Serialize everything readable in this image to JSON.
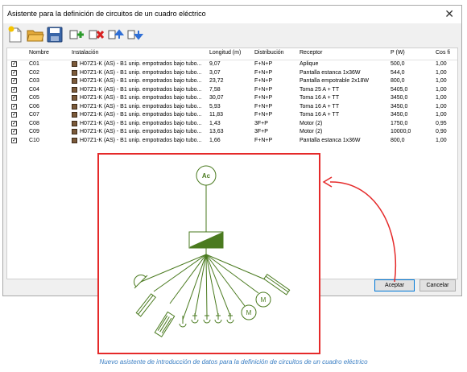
{
  "window": {
    "title": "Asistente para la definición de circuitos de un cuadro eléctrico",
    "close_glyph": "✕"
  },
  "toolbar": {
    "icons": [
      "new-document-icon",
      "open-folder-icon",
      "save-icon",
      "add-circuit-icon",
      "delete-circuit-icon",
      "move-up-icon",
      "move-down-icon"
    ]
  },
  "table": {
    "headers": {
      "name": "Nombre",
      "installation": "Instalación",
      "length": "Longitud (m)",
      "distribution": "Distribución",
      "receiver": "Receptor",
      "power": "P (W)",
      "cosphi": "Cos fi"
    },
    "rows": [
      {
        "checked": true,
        "name": "C01",
        "installation": "H07Z1-K (AS) - B1 unip. empotrados bajo tubo...",
        "length": "9,07",
        "distribution": "F+N+P",
        "receiver": "Aplique",
        "power": "500,0",
        "cosphi": "1,00"
      },
      {
        "checked": true,
        "name": "C02",
        "installation": "H07Z1-K (AS) - B1 unip. empotrados bajo tubo...",
        "length": "3,07",
        "distribution": "F+N+P",
        "receiver": "Pantalla estanca 1x36W",
        "power": "544,0",
        "cosphi": "1,00"
      },
      {
        "checked": true,
        "name": "C03",
        "installation": "H07Z1-K (AS) - B1 unip. empotrados bajo tubo...",
        "length": "23,72",
        "distribution": "F+N+P",
        "receiver": "Pantalla empotrable 2x18W",
        "power": "800,0",
        "cosphi": "1,00"
      },
      {
        "checked": true,
        "name": "C04",
        "installation": "H07Z1-K (AS) - B1 unip. empotrados bajo tubo...",
        "length": "7,58",
        "distribution": "F+N+P",
        "receiver": "Toma 25 A + TT",
        "power": "5405,0",
        "cosphi": "1,00"
      },
      {
        "checked": true,
        "name": "C05",
        "installation": "H07Z1-K (AS) - B1 unip. empotrados bajo tubo...",
        "length": "30,07",
        "distribution": "F+N+P",
        "receiver": "Toma 16 A + TT",
        "power": "3450,0",
        "cosphi": "1,00"
      },
      {
        "checked": true,
        "name": "C06",
        "installation": "H07Z1-K (AS) - B1 unip. empotrados bajo tubo...",
        "length": "5,93",
        "distribution": "F+N+P",
        "receiver": "Toma 16 A + TT",
        "power": "3450,0",
        "cosphi": "1,00"
      },
      {
        "checked": true,
        "name": "C07",
        "installation": "H07Z1-K (AS) - B1 unip. empotrados bajo tubo...",
        "length": "11,83",
        "distribution": "F+N+P",
        "receiver": "Toma 16 A + TT",
        "power": "3450,0",
        "cosphi": "1,00"
      },
      {
        "checked": true,
        "name": "C08",
        "installation": "H07Z1-K (AS) - B1 unip. empotrados bajo tubo...",
        "length": "1,43",
        "distribution": "3F+P",
        "receiver": "Motor (2)",
        "power": "1750,0",
        "cosphi": "0,95"
      },
      {
        "checked": true,
        "name": "C09",
        "installation": "H07Z1-K (AS) - B1 unip. empotrados bajo tubo...",
        "length": "13,63",
        "distribution": "3F+P",
        "receiver": "Motor (2)",
        "power": "10000,0",
        "cosphi": "0,90"
      },
      {
        "checked": true,
        "name": "C10",
        "installation": "H07Z1-K (AS) - B1 unip. empotrados bajo tubo...",
        "length": "1,66",
        "distribution": "F+N+P",
        "receiver": "Pantalla estanca 1x36W",
        "power": "800,0",
        "cosphi": "1,00"
      }
    ]
  },
  "buttons": {
    "accept": "Aceptar",
    "cancel": "Cancelar"
  },
  "diagram": {
    "top_symbol_label": "Ac",
    "motor_label": "M",
    "line_color": "#4a7a1f"
  },
  "accent": {
    "highlight": "#e52a2a",
    "caption_color": "#3b7fc4"
  },
  "caption": "Nuevo asistente de introducción de datos para la definición de circuitos de un cuadro eléctrico"
}
